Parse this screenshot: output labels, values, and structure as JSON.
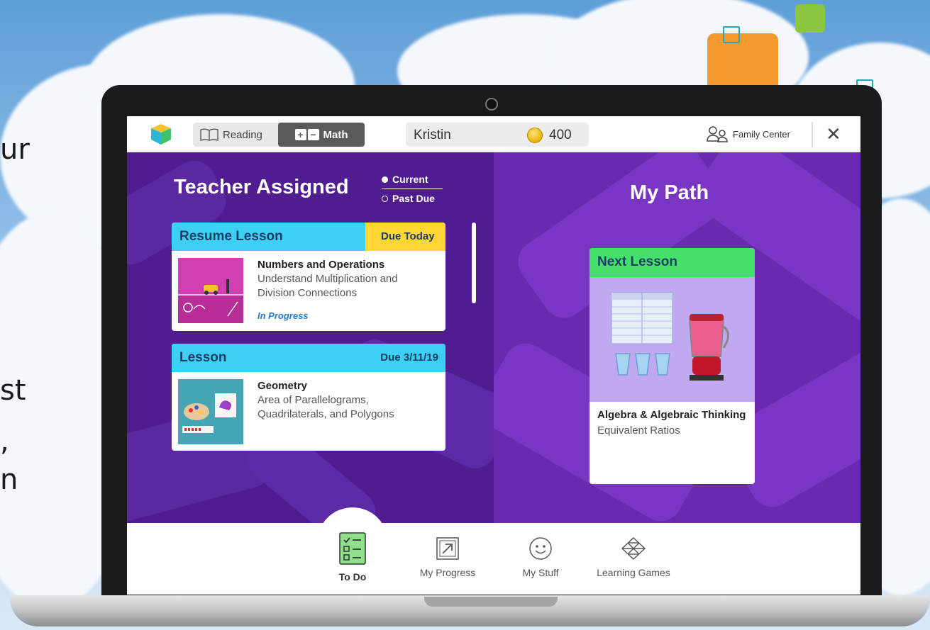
{
  "background_text": [
    "ur",
    "st",
    ",",
    "n"
  ],
  "topbar": {
    "subject_tabs": {
      "reading_label": "Reading",
      "math_label": "Math",
      "selected": "Math"
    },
    "user_name": "Kristin",
    "coin_count": "400",
    "family_center_label": "Family Center",
    "close_label": "✕"
  },
  "teacher_assigned": {
    "title": "Teacher Assigned",
    "filters": [
      "Current",
      "Past Due"
    ],
    "selected_filter": "Current",
    "cards": [
      {
        "header": "Resume Lesson",
        "due": "Due Today",
        "topic": "Numbers and Operations",
        "description_lines": [
          "Understand Multiplication and",
          "Division Connections"
        ],
        "status": "In Progress"
      },
      {
        "header": "Lesson",
        "due": "Due 3/11/19",
        "topic": "Geometry",
        "description_lines": [
          "Area of Parallelograms,",
          "Quadrilaterals, and Polygons"
        ],
        "status": ""
      }
    ]
  },
  "my_path": {
    "title": "My Path",
    "next_lesson": {
      "header": "Next Lesson",
      "topic": "Algebra & Algebraic Thinking",
      "description": "Equivalent Ratios"
    }
  },
  "bottom_nav": [
    {
      "label": "To Do",
      "icon": "checklist-icon",
      "active": true
    },
    {
      "label": "My Progress",
      "icon": "arrow-box-icon",
      "active": false
    },
    {
      "label": "My Stuff",
      "icon": "smiley-icon",
      "active": false
    },
    {
      "label": "Learning Games",
      "icon": "geometric-shape-icon",
      "active": false
    }
  ],
  "colors": {
    "header_blue": "#3dd0f4",
    "due_yellow": "#ffd633",
    "next_green": "#45e06b",
    "left_purple": "#4f1d8f",
    "right_purple": "#6a2ab0"
  }
}
